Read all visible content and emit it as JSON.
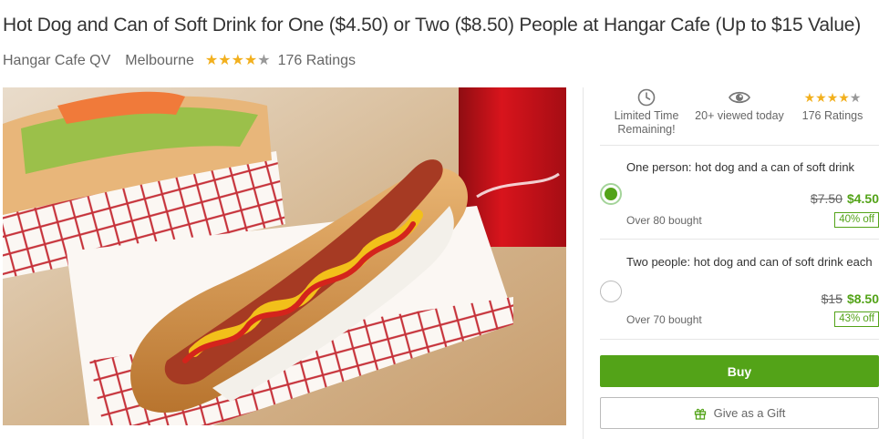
{
  "deal": {
    "title": "Hot Dog and Can of Soft Drink for One ($4.50) or Two ($8.50) People at Hangar Cafe (Up to $15 Value)",
    "merchant": "Hangar Cafe QV",
    "location": "Melbourne",
    "rating": 4,
    "rating_max": 5,
    "ratings_label": "176 Ratings",
    "image_icon": "hot-dog-photo"
  },
  "stats": [
    {
      "icon": "clock-icon",
      "label": "Limited Time Remaining!"
    },
    {
      "icon": "eye-icon",
      "label": "20+ viewed today"
    },
    {
      "icon": "star-rating-icon",
      "label": "176 Ratings"
    }
  ],
  "options": [
    {
      "title": "One person: hot dog and a can of soft drink",
      "old_price": "$7.50",
      "new_price": "$4.50",
      "bought": "Over 80 bought",
      "discount": "40% off",
      "selected": true
    },
    {
      "title": "Two people: hot dog and can of soft drink each",
      "old_price": "$15",
      "new_price": "$8.50",
      "bought": "Over 70 bought",
      "discount": "43% off",
      "selected": false
    }
  ],
  "actions": {
    "buy_label": "Buy",
    "gift_label": "Give as a Gift"
  },
  "colors": {
    "accent": "#53a318",
    "star": "#f2b01e",
    "text": "#333333"
  }
}
